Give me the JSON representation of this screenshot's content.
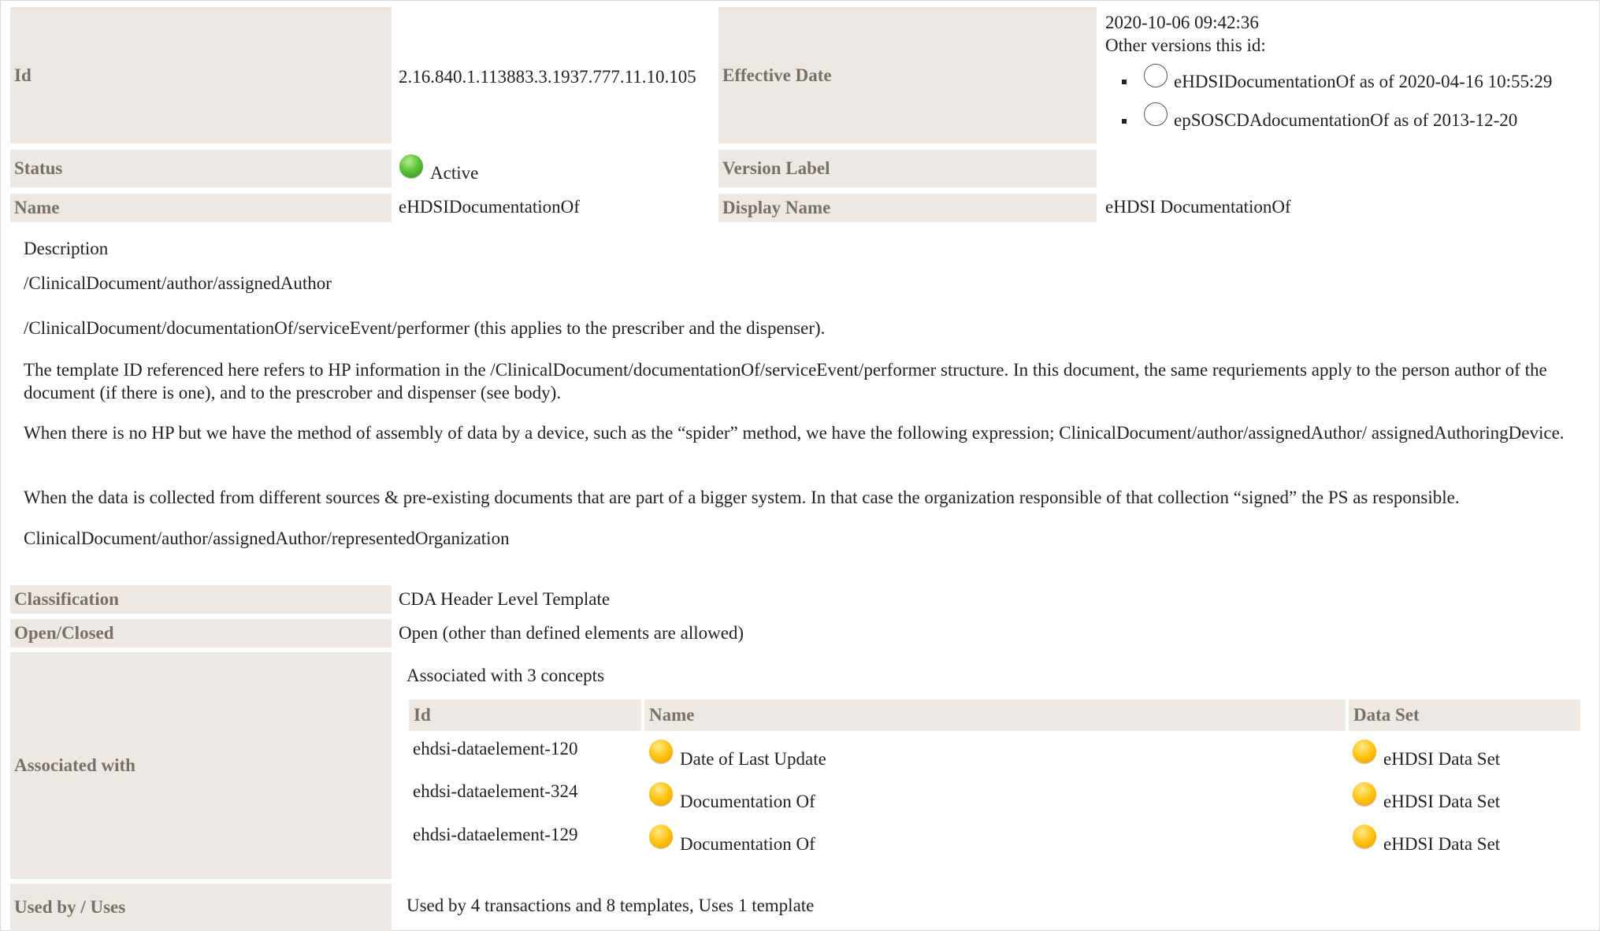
{
  "id_row": {
    "label": "Id",
    "value": "2.16.840.1.113883.3.1937.777.11.10.105"
  },
  "effective_date": {
    "label": "Effective Date",
    "value": "2020-10-06 09:42:36",
    "other_versions_label": "Other versions this id:",
    "versions": [
      {
        "text": "eHDSIDocumentationOf as of 2020-04-16 10:55:29"
      },
      {
        "text": "epSOSCDAdocumentationOf as of 2013-12-20"
      }
    ]
  },
  "status": {
    "label": "Status",
    "value": "Active",
    "icon": "green-status-dot"
  },
  "version_label": {
    "label": "Version Label",
    "value": ""
  },
  "name": {
    "label": "Name",
    "value": "eHDSIDocumentationOf"
  },
  "display_name": {
    "label": "Display Name",
    "value": "eHDSI DocumentationOf"
  },
  "description": {
    "heading": "Description",
    "paragraphs": [
      "/ClinicalDocument/author/assignedAuthor",
      "/ClinicalDocument/documentationOf/serviceEvent/performer (this applies to the prescriber and the dispenser).",
      "The template ID referenced here refers to HP information in the /ClinicalDocument/documentationOf/serviceEvent/performer structure. In this document, the same requriements apply to the person author of the document (if there is one), and to the prescrober and dispenser (see body).",
      "When there is no HP but we have the method of assembly of data by a device, such as the “spider” method, we have the following expression; ClinicalDocument/author/assignedAuthor/ assignedAuthoringDevice.",
      "When the data is collected from different sources & pre-existing documents that are part of a bigger system. In that case the organization responsible of that collection “signed” the PS as responsible.",
      "ClinicalDocument/author/assignedAuthor/representedOrganization"
    ]
  },
  "classification": {
    "label": "Classification",
    "value": "CDA Header Level Template"
  },
  "open_closed": {
    "label": "Open/Closed",
    "value": "Open (other than defined elements are allowed)"
  },
  "associated": {
    "label": "Associated with",
    "summary": "Associated with 3 concepts",
    "columns": {
      "id": "Id",
      "name": "Name",
      "dataset": "Data Set"
    },
    "rows": [
      {
        "id": "ehdsi-dataelement-120",
        "name": "Date of Last Update",
        "dataset": "eHDSI Data Set"
      },
      {
        "id": "ehdsi-dataelement-324",
        "name": "Documentation Of",
        "dataset": "eHDSI Data Set"
      },
      {
        "id": "ehdsi-dataelement-129",
        "name": "Documentation Of",
        "dataset": "eHDSI Data Set"
      }
    ]
  },
  "used_by": {
    "label": "Used by / Uses",
    "value": "Used by 4 transactions and 8 templates, Uses 1 template"
  },
  "colors": {
    "label_bg": "#ece9e4",
    "label_text": "#7a6f62",
    "status_green": "#4cb82e",
    "concept_yellow": "#ffc20e"
  }
}
